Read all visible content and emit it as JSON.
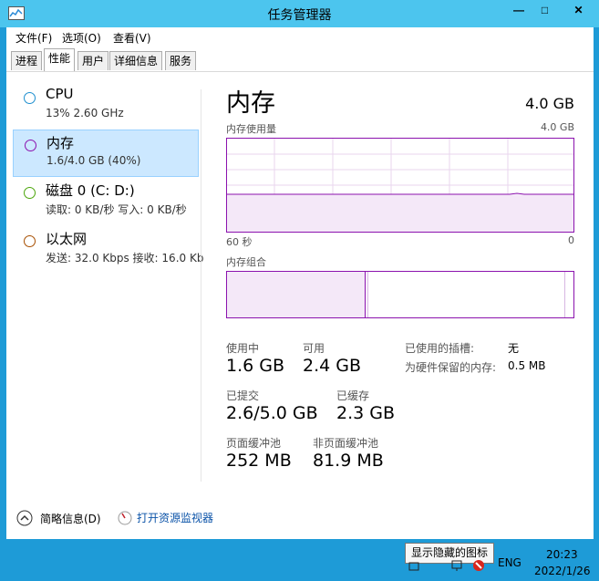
{
  "window": {
    "title": "任务管理器",
    "controls": {
      "minimize": "—",
      "maximize": "□",
      "close": "✕"
    }
  },
  "menu": [
    "文件(F)",
    "选项(O)",
    "查看(V)"
  ],
  "tabs": [
    "进程",
    "性能",
    "用户",
    "详细信息",
    "服务"
  ],
  "active_tab": "性能",
  "resources": [
    {
      "name": "CPU",
      "detail": "13% 2.60 GHz",
      "color": "#1e8fcf"
    },
    {
      "name": "内存",
      "detail": "1.6/4.0 GB (40%)",
      "color": "#8b12ae"
    },
    {
      "name": "磁盘 0 (C: D:)",
      "detail": "读取: 0 KB/秒 写入: 0 KB/秒",
      "color": "#4da60c"
    },
    {
      "name": "以太网",
      "detail": "发送: 32.0 Kbps 接收: 16.0 Kb",
      "color": "#a74f01"
    }
  ],
  "memory": {
    "title": "内存",
    "total": "4.0 GB",
    "usage_graph_label": "内存使用量",
    "usage_graph_max": "4.0 GB",
    "time_left": "60 秒",
    "time_right": "0",
    "composition_label": "内存组合",
    "stats": {
      "in_use_label": "使用中",
      "in_use": "1.6 GB",
      "available_label": "可用",
      "available": "2.4 GB",
      "committed_label": "已提交",
      "committed": "2.6/5.0 GB",
      "cached_label": "已缓存",
      "cached": "2.3 GB",
      "paged_label": "页面缓冲池",
      "paged": "252 MB",
      "nonpaged_label": "非页面缓冲池",
      "nonpaged": "81.9 MB",
      "slots_label": "已使用的插槽:",
      "slots": "无",
      "reserved_label": "为硬件保留的内存:",
      "reserved": "0.5 MB"
    },
    "usage_fraction": 0.4
  },
  "footer": {
    "summary_label": "简略信息(D)",
    "monitor_label": "打开资源监视器"
  },
  "taskbar": {
    "tooltip": "显示隐藏的图标",
    "lang": "ENG",
    "time": "20:23",
    "date": "2022/1/26"
  },
  "colors": {
    "memory_accent": "#8b12ae",
    "titlebar": "#4cc5ee",
    "taskbar": "#1e9bd7"
  }
}
